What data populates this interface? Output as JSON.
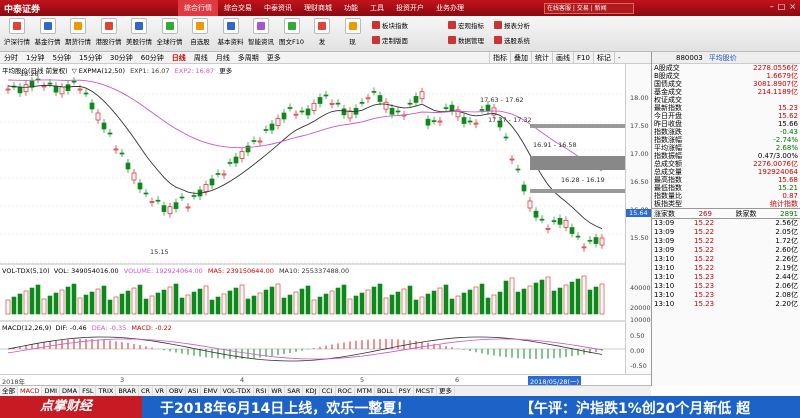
{
  "app": {
    "brand": "中泰证券",
    "search_placeholder": "在线客服 | 交易 | 新闻"
  },
  "top_menu": [
    {
      "label": "综合行情",
      "active": true
    },
    {
      "label": "综合交易",
      "active": false
    },
    {
      "label": "中泰资讯",
      "active": false
    },
    {
      "label": "理财商城",
      "active": false
    },
    {
      "label": "功能",
      "active": false
    },
    {
      "label": "工具",
      "active": false
    },
    {
      "label": "投资开户",
      "active": false
    },
    {
      "label": "业务办理",
      "active": false
    }
  ],
  "toolbar": {
    "items": [
      "沪深行情",
      "基金行情",
      "期货行情",
      "港股行情",
      "美股行情",
      "全球行情",
      "自选股",
      "基本资料",
      "智能资讯",
      "图文F10",
      "发",
      "现"
    ],
    "small": [
      "板块指数",
      "宏观指标",
      "报表分析",
      "定制版面",
      "数据管理",
      "选股系统"
    ]
  },
  "chart_tabs": [
    "分时",
    "1分钟",
    "5分钟",
    "15分钟",
    "30分钟",
    "60分钟",
    "日线",
    "周线",
    "月线",
    "多周期",
    "更多"
  ],
  "chart_tabs_active": "日线",
  "chart_tools": [
    "指标",
    "叠加",
    "统计",
    "画线",
    "F10",
    "标记",
    "-"
  ],
  "legend": {
    "main": "平均股价(日线 前复权)",
    "expma": "▽ EXPMA(12,50)",
    "exp1": "EXP1: 16.07",
    "exp2": "EXP2: 16.87",
    "more": "更多",
    "vol": "VOL-TDX(5,10)",
    "vol_val": "VOL: 349054016.00",
    "vol_volume": "VOLUME: 192924064.00",
    "vol_ma5": "MA5: 239150644.00",
    "vol_ma10": "MA10: 255337488.00",
    "macd": "MACD(12,26,9)",
    "dif": "DIF: -0.46",
    "dea": "DEA: -0.35",
    "macd_val": "MACD: -0.22"
  },
  "annotations": [
    "18.28",
    "17.63 - 17.62",
    "17.37 - 17.32",
    "16.91 - 16.58",
    "16.28 - 16.19",
    "15.15"
  ],
  "axis": {
    "labels": [
      "18.00",
      "17.50",
      "17.00",
      "16.50",
      "16.00",
      "15.50"
    ],
    "current": "15.64",
    "vol_labels": [
      "40000",
      "20000",
      "10000"
    ],
    "macd_labels": [
      "0.50",
      "0.00",
      "-0.50"
    ]
  },
  "dates": {
    "year": "2018年",
    "months": [
      "3",
      "4",
      "5",
      "6"
    ],
    "highlight": "2018/05/28(一)"
  },
  "bottom_tabs": [
    "全部",
    "MACD",
    "DMI",
    "DMA",
    "FSL",
    "TRIX",
    "BRAR",
    "CR",
    "VR",
    "OBV",
    "ASI",
    "EMV",
    "VOL-TDX",
    "RSI",
    "WR",
    "SAR",
    "KDJ",
    "CCI",
    "ROC",
    "MTM",
    "BOLL",
    "PSY",
    "MCST",
    "更多"
  ],
  "bottom_active": "MACD",
  "sidebar": {
    "code": "880003",
    "name": "平均股价",
    "rows": [
      {
        "label": "A股成交",
        "value": "2278.0556亿",
        "color": "red"
      },
      {
        "label": "B股成交",
        "value": "1.6679亿",
        "color": "red"
      },
      {
        "label": "国债成交",
        "value": "3081.8907亿",
        "color": "red"
      },
      {
        "label": "基金成交",
        "value": "214.1189亿",
        "color": "red"
      },
      {
        "label": "权证成交",
        "value": "",
        "color": "red"
      },
      {
        "label": "最新指数",
        "value": "15.23",
        "color": "red"
      },
      {
        "label": "今日开盘",
        "value": "15.62",
        "color": "red"
      },
      {
        "label": "昨日收盘",
        "value": "15.66",
        "color": "blk"
      },
      {
        "label": "指数涨跌",
        "value": "-0.43",
        "color": "grn"
      },
      {
        "label": "指数涨幅",
        "value": "-2.74%",
        "color": "grn"
      },
      {
        "label": "平均涨幅",
        "value": "2.68%",
        "color": "grn"
      },
      {
        "label": "指数振幅",
        "value": "0.47/3.00%",
        "color": "blk"
      },
      {
        "label": "总成交额",
        "value": "2276.0076亿",
        "color": "red"
      },
      {
        "label": "总成交量",
        "value": "192924064",
        "color": "red"
      },
      {
        "label": "最高指数",
        "value": "15.68",
        "color": "red"
      },
      {
        "label": "最低指数",
        "value": "15.21",
        "color": "grn"
      },
      {
        "label": "指数量比",
        "value": "0.87",
        "color": "red"
      },
      {
        "label": "板指类型",
        "value": "统计指数",
        "color": "red"
      }
    ],
    "updown": {
      "up_label": "涨家数",
      "up": "269",
      "down_label": "跌家数",
      "down": "2891"
    },
    "ticks": [
      {
        "time": "13:09",
        "price": "15.22",
        "amt": "2.56亿"
      },
      {
        "time": "13:09",
        "price": "15.22",
        "amt": "2.05亿"
      },
      {
        "time": "13:09",
        "price": "15.22",
        "amt": "1.72亿"
      },
      {
        "time": "13:09",
        "price": "15.22",
        "amt": "2.60亿"
      },
      {
        "time": "13:10",
        "price": "15.22",
        "amt": "2.26亿"
      },
      {
        "time": "13:10",
        "price": "15.22",
        "amt": "2.19亿"
      },
      {
        "time": "13:10",
        "price": "15.23",
        "amt": "2.44亿"
      },
      {
        "time": "13:10",
        "price": "15.23",
        "amt": "2.06亿"
      },
      {
        "time": "13:10",
        "price": "15.23",
        "amt": "2.08亿"
      },
      {
        "time": "13:10",
        "price": "15.23",
        "amt": "2.20亿"
      }
    ]
  },
  "ticker": {
    "brand": "点掌财经",
    "msg1": "于2018年6月14日上线，欢乐一整夏！",
    "msg2": "【午评：沪指跌1%创20个月新低 超"
  },
  "colors": {
    "up": "#e02020",
    "down": "#0b8a1a",
    "exp1": "#333333",
    "exp2": "#cc55cc"
  }
}
